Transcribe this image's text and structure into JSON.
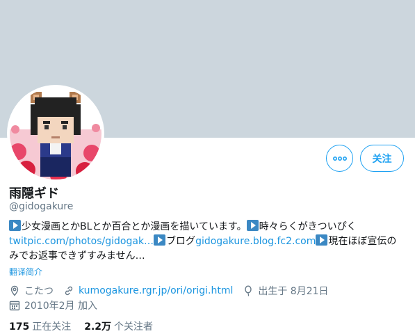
{
  "profile": {
    "display_name": "雨隠ギド",
    "handle": "@gidogakure",
    "bio": {
      "seg1": "少女漫画とかBLとか百合とか漫画を描いています。",
      "seg2": "時々らくがきついぴく",
      "link1": "twitpic.com/photos/gidogak…",
      "seg3": "ブログ",
      "link2": "gidogakure.blog.fc2.com",
      "seg4": "現在ほぼ宣伝のみでお返事できずすみません…"
    },
    "translate_label": "翻译简介",
    "location": "こたつ",
    "website": "kumogakure.rgr.jp/ori/origi.html",
    "birthday": "出生于 8月21日",
    "joined": "2010年2月 加入",
    "following_count": "175",
    "following_label": "正在关注",
    "followers_count": "2.2万",
    "followers_label": "个关注者"
  },
  "actions": {
    "follow_label": "关注",
    "more_icon": "more-dots-icon"
  },
  "colors": {
    "banner": "#ccd6dd",
    "accent": "#1da1f2",
    "link": "#1b95e0",
    "muted": "#657786",
    "text": "#14171a"
  },
  "icons": [
    "location-icon",
    "link-icon",
    "balloon-icon",
    "calendar-icon"
  ]
}
